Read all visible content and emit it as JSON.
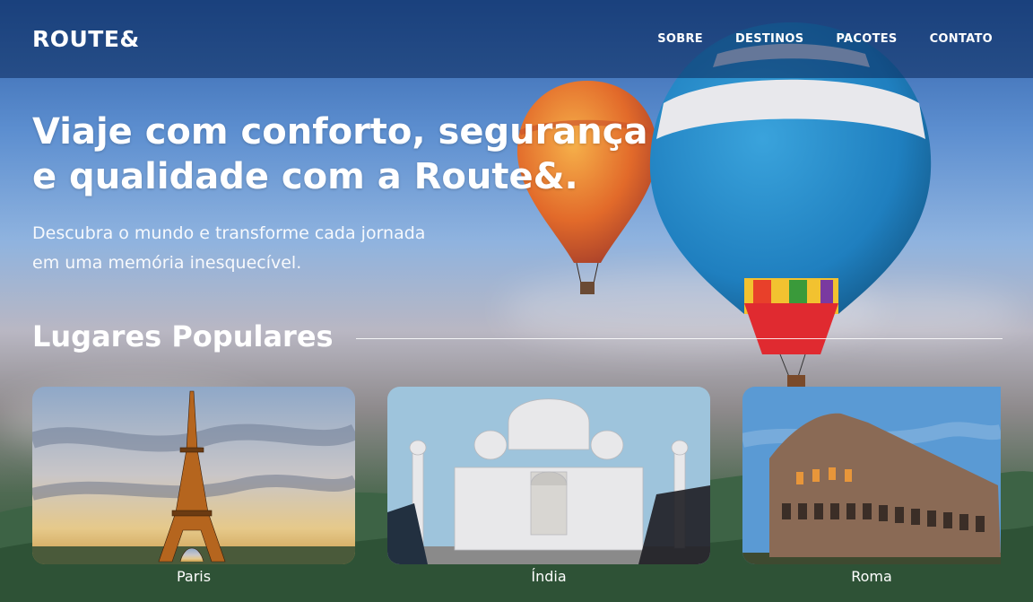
{
  "header": {
    "logo": "ROUTE&",
    "nav": [
      "SOBRE",
      "DESTINOS",
      "PACOTES",
      "CONTATO"
    ]
  },
  "hero": {
    "title_line1": "Viaje com conforto, segurança",
    "title_line2": "e qualidade com a Route&.",
    "subtitle_line1": "Descubra o mundo e transforme cada jornada",
    "subtitle_line2": "em uma memória inesquecível."
  },
  "popular": {
    "heading": "Lugares Populares",
    "places": [
      {
        "name": "Paris",
        "icon": "eiffel-tower"
      },
      {
        "name": "Índia",
        "icon": "taj-mahal"
      },
      {
        "name": "Roma",
        "icon": "colosseum"
      }
    ]
  },
  "colors": {
    "header_bg": "#0a285a",
    "sky_top": "#2f5fa8",
    "hill_green": "#2e5236"
  }
}
